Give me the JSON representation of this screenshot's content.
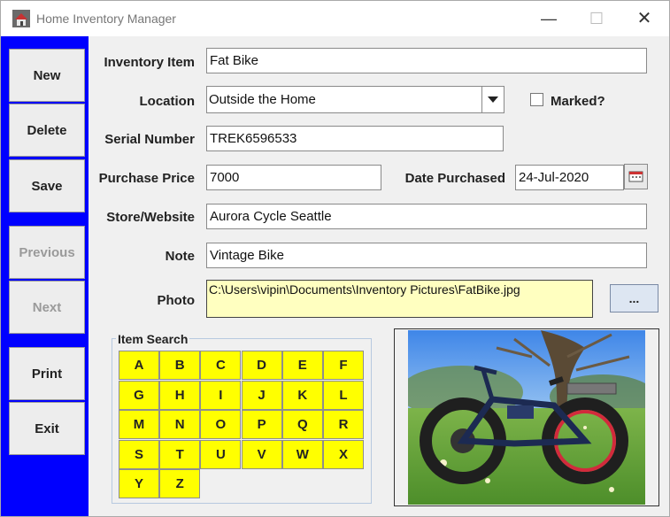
{
  "window": {
    "title": "Home Inventory Manager",
    "min_glyph": "—",
    "max_glyph": "☐",
    "close_glyph": "✕"
  },
  "toolbar": {
    "new_label": "New",
    "delete_label": "Delete",
    "save_label": "Save",
    "previous_label": "Previous",
    "next_label": "Next",
    "print_label": "Print",
    "exit_label": "Exit"
  },
  "form": {
    "inventory_item_label": "Inventory Item",
    "inventory_item_value": "Fat Bike",
    "location_label": "Location",
    "location_value": "Outside the Home",
    "marked_label": "Marked?",
    "marked_checked": false,
    "serial_label": "Serial Number",
    "serial_value": "TREK6596533",
    "price_label": "Purchase Price",
    "price_value": "7000",
    "date_label": "Date Purchased",
    "date_value": "24-Jul-2020",
    "store_label": "Store/Website",
    "store_value": "Aurora Cycle Seattle",
    "note_label": "Note",
    "note_value": "Vintage Bike",
    "photo_label": "Photo",
    "photo_path": "C:\\Users\\vipin\\Documents\\Inventory Pictures\\FatBike.jpg",
    "browse_label": "..."
  },
  "search": {
    "title": "Item Search",
    "letters": [
      "A",
      "B",
      "C",
      "D",
      "E",
      "F",
      "G",
      "H",
      "I",
      "J",
      "K",
      "L",
      "M",
      "N",
      "O",
      "P",
      "Q",
      "R",
      "S",
      "T",
      "U",
      "V",
      "W",
      "X",
      "Y",
      "Z"
    ]
  },
  "colors": {
    "side_panel": "#0000ff",
    "letter_button": "#ffff00",
    "photo_field": "#ffffc0"
  }
}
